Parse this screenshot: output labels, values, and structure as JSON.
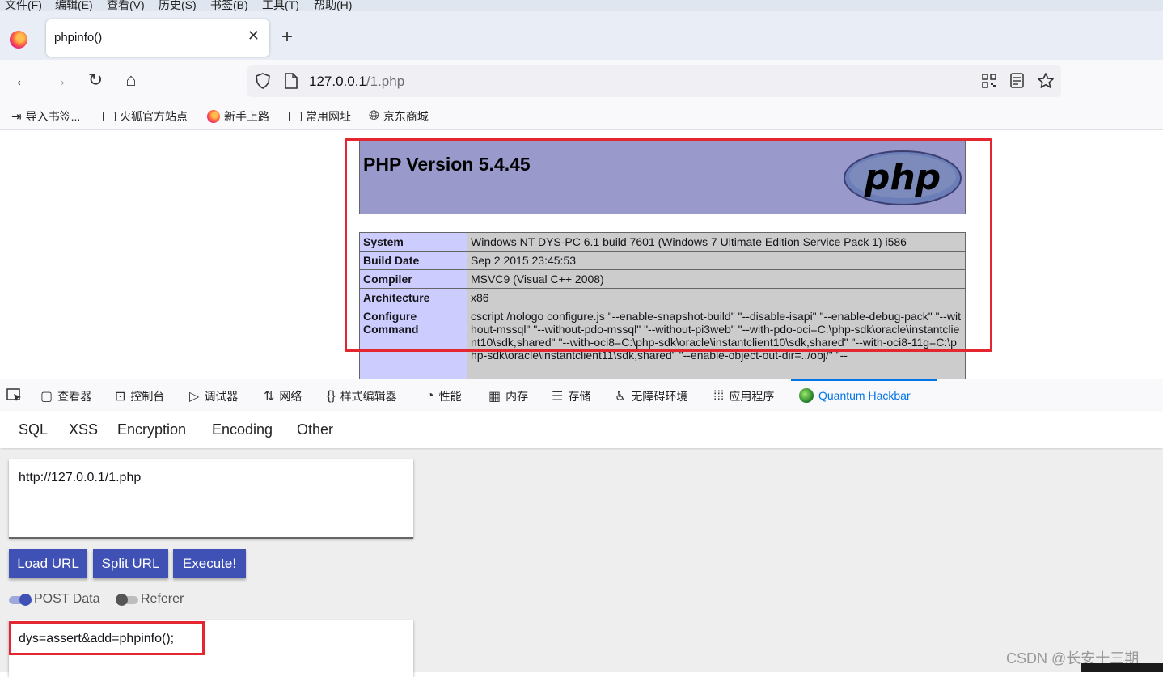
{
  "menubar": [
    "文件(F)",
    "编辑(E)",
    "查看(V)",
    "历史(S)",
    "书签(B)",
    "工具(T)",
    "帮助(H)"
  ],
  "tab": {
    "title": "phpinfo()",
    "close": "✕",
    "new_tab": "+"
  },
  "nav": {
    "back": "←",
    "forward": "→",
    "reload": "↻",
    "home": "⌂"
  },
  "url": {
    "host": "127.0.0.1",
    "path": "/1.php"
  },
  "bookmarks": [
    "导入书签...",
    "火狐官方站点",
    "新手上路",
    "常用网址",
    "京东商城"
  ],
  "phpinfo": {
    "version_title": "PHP Version 5.4.45",
    "logo_text": "php",
    "rows": [
      {
        "key": "System",
        "value": "Windows NT DYS-PC 6.1 build 7601 (Windows 7 Ultimate Edition Service Pack 1) i586"
      },
      {
        "key": "Build Date",
        "value": "Sep 2 2015 23:45:53"
      },
      {
        "key": "Compiler",
        "value": "MSVC9 (Visual C++ 2008)"
      },
      {
        "key": "Architecture",
        "value": "x86"
      },
      {
        "key": "Configure Command",
        "value": "cscript /nologo configure.js \"--enable-snapshot-build\" \"--disable-isapi\" \"--enable-debug-pack\" \"--without-mssql\" \"--without-pdo-mssql\" \"--without-pi3web\" \"--with-pdo-oci=C:\\php-sdk\\oracle\\instantclient10\\sdk,shared\" \"--with-oci8=C:\\php-sdk\\oracle\\instantclient10\\sdk,shared\" \"--with-oci8-11g=C:\\php-sdk\\oracle\\instantclient11\\sdk,shared\" \"--enable-object-out-dir=../obj/\" \"--"
      }
    ]
  },
  "devtools": {
    "inspector": "查看器",
    "console": "控制台",
    "debugger": "调试器",
    "network": "网络",
    "style_editor": "样式编辑器",
    "performance": "性能",
    "memory": "内存",
    "storage": "存储",
    "accessibility": "无障碍环境",
    "application": "应用程序",
    "hackbar": "Quantum Hackbar"
  },
  "hackbar": {
    "menu": [
      "SQL",
      "XSS",
      "Encryption",
      "Encoding",
      "Other"
    ],
    "url_value": "http://127.0.0.1/1.php",
    "buttons": {
      "load": "Load URL",
      "split": "Split URL",
      "execute": "Execute!"
    },
    "post_data_label": "POST Data",
    "post_data_enabled": true,
    "referer_label": "Referer",
    "referer_enabled": false,
    "post_value": "dys=assert&add=phpinfo();",
    "accent_color": "#3f51b5"
  },
  "watermark": "CSDN @长安十三期",
  "highlight_color": "#e3262f"
}
